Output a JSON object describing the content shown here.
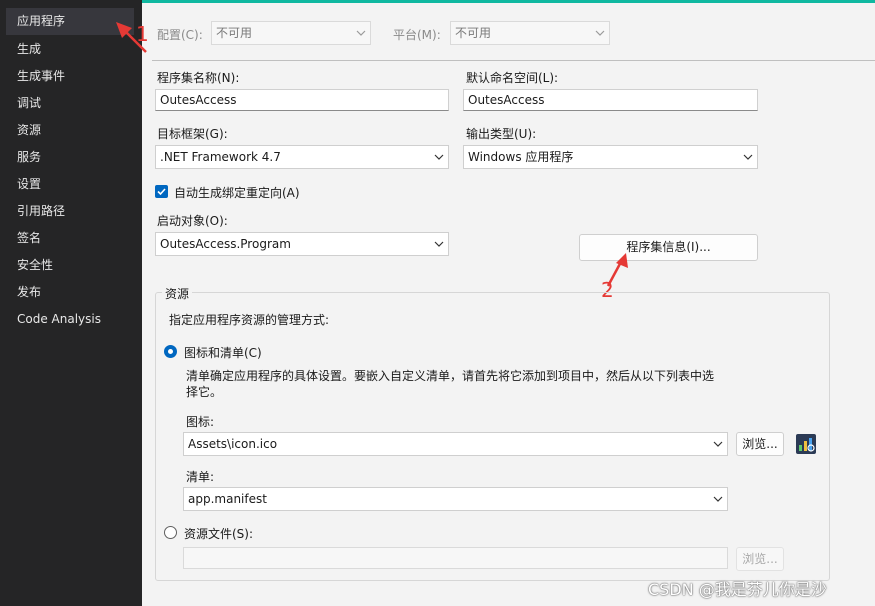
{
  "sidebar": {
    "items": [
      {
        "label": "应用程序"
      },
      {
        "label": "生成"
      },
      {
        "label": "生成事件"
      },
      {
        "label": "调试"
      },
      {
        "label": "资源"
      },
      {
        "label": "服务"
      },
      {
        "label": "设置"
      },
      {
        "label": "引用路径"
      },
      {
        "label": "签名"
      },
      {
        "label": "安全性"
      },
      {
        "label": "发布"
      },
      {
        "label": "Code Analysis"
      }
    ]
  },
  "toolbar": {
    "config_label": "配置(C):",
    "config_value": "不可用",
    "platform_label": "平台(M):",
    "platform_value": "不可用"
  },
  "form": {
    "assembly_name_label": "程序集名称(N):",
    "assembly_name_value": "OutesAccess",
    "default_ns_label": "默认命名空间(L):",
    "default_ns_value": "OutesAccess",
    "target_fw_label": "目标框架(G):",
    "target_fw_value": ".NET Framework 4.7",
    "output_type_label": "输出类型(U):",
    "output_type_value": "Windows 应用程序",
    "auto_binding_label": "自动生成绑定重定向(A)",
    "startup_label": "启动对象(O):",
    "startup_value": "OutesAccess.Program",
    "assembly_info_button": "程序集信息(I)..."
  },
  "resources": {
    "group_title": "资源",
    "instruction": "指定应用程序资源的管理方式:",
    "icon_manifest_label": "图标和清单(C)",
    "description_line1": "清单确定应用程序的具体设置。要嵌入自定义清单，请首先将它添加到项目中，然后从以下列表中选",
    "description_line2": "择它。",
    "icon_label": "图标:",
    "icon_value": "Assets\\icon.ico",
    "browse_label": "浏览...",
    "manifest_label": "清单:",
    "manifest_value": "app.manifest",
    "resource_file_label": "资源文件(S):",
    "resource_browse_label": "浏览..."
  },
  "annotations": {
    "one": "1",
    "two": "2"
  },
  "watermark": "CSDN @我是芬儿你是沙"
}
